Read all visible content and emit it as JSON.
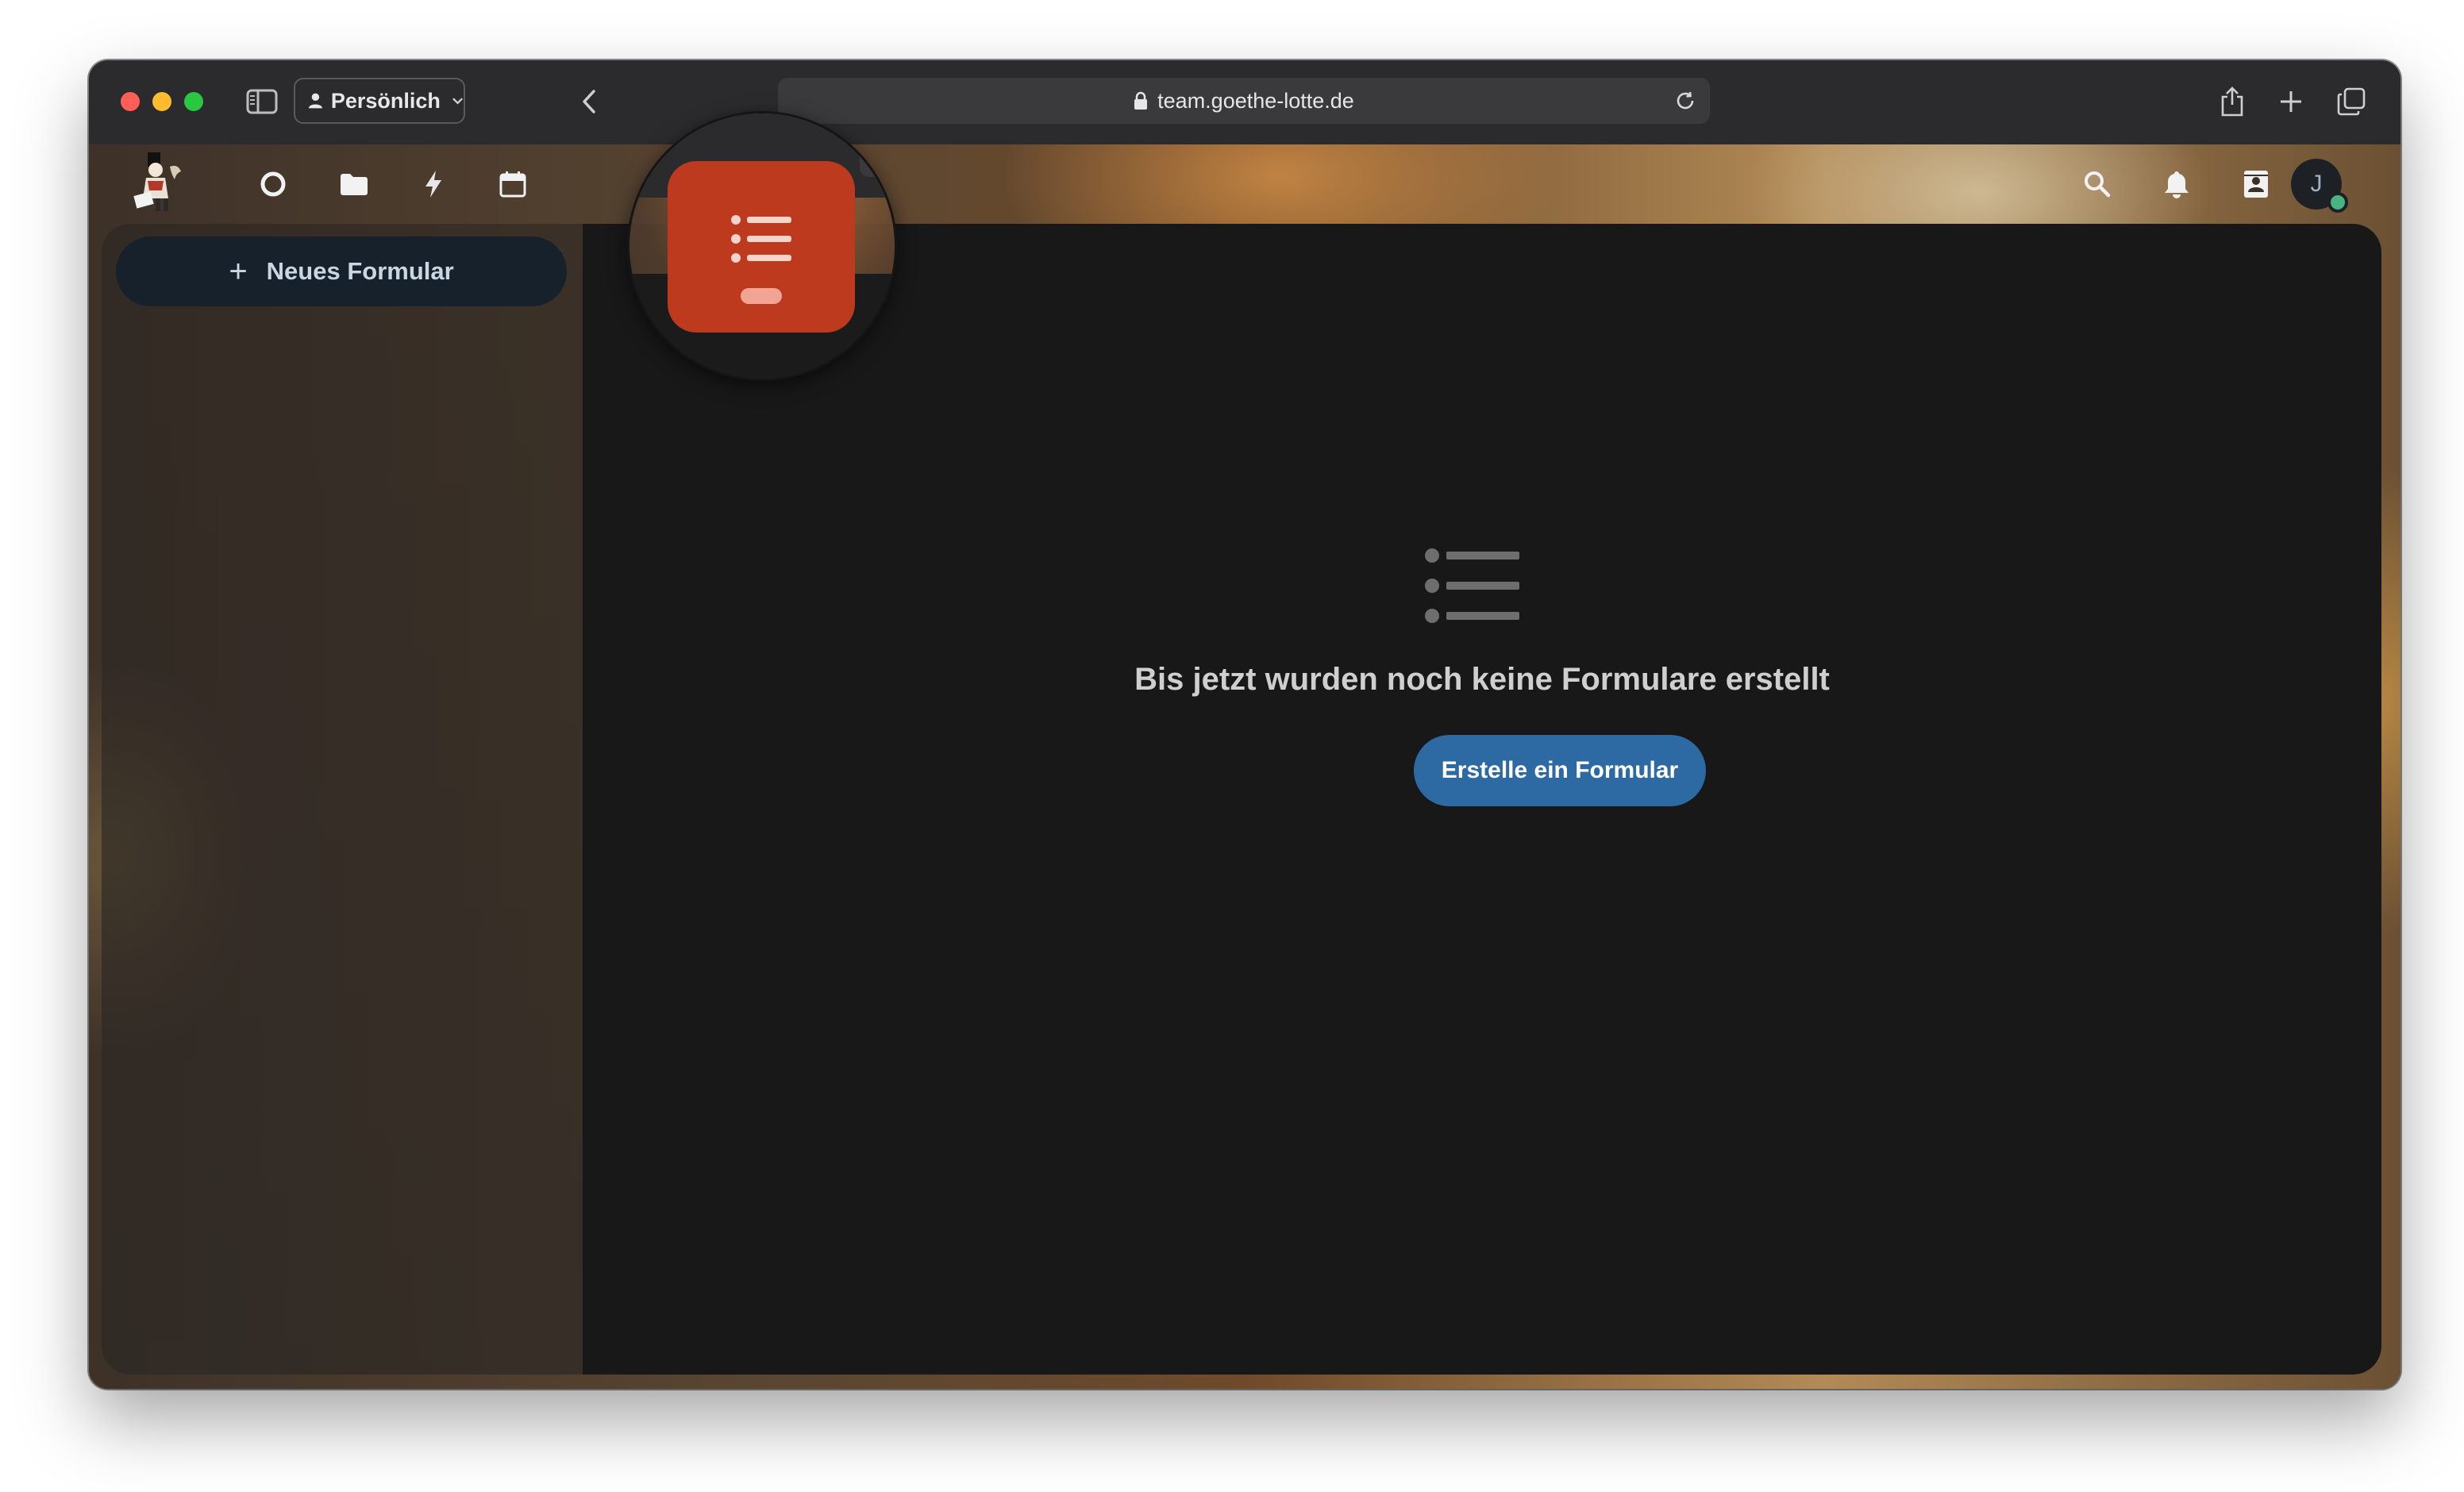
{
  "browser": {
    "profile_label": "Persönlich",
    "url": "team.goethe-lotte.de"
  },
  "header": {
    "apps": [
      {
        "name": "dashboard",
        "icon": "circle-icon"
      },
      {
        "name": "files",
        "icon": "folder-icon"
      },
      {
        "name": "activity",
        "icon": "lightning-icon"
      },
      {
        "name": "calendar",
        "icon": "calendar-icon"
      },
      {
        "name": "forms",
        "icon": "list-icon",
        "active": true
      }
    ],
    "right_icons": [
      "search-icon",
      "bell-icon",
      "contacts-icon"
    ],
    "avatar_initial": "J",
    "status_color": "#49b382"
  },
  "navigation": {
    "new_form_label": "Neues Formular",
    "new_form_icon": "plus-icon"
  },
  "main": {
    "empty_icon": "list-icon",
    "empty_message": "Bis jetzt wurden noch keine Formulare erstellt",
    "create_button_label": "Erstelle ein Formular"
  },
  "colors": {
    "primary": "#2d6aa3",
    "forms_app_highlight": "#bd3a1f",
    "content_background": "#181818"
  }
}
